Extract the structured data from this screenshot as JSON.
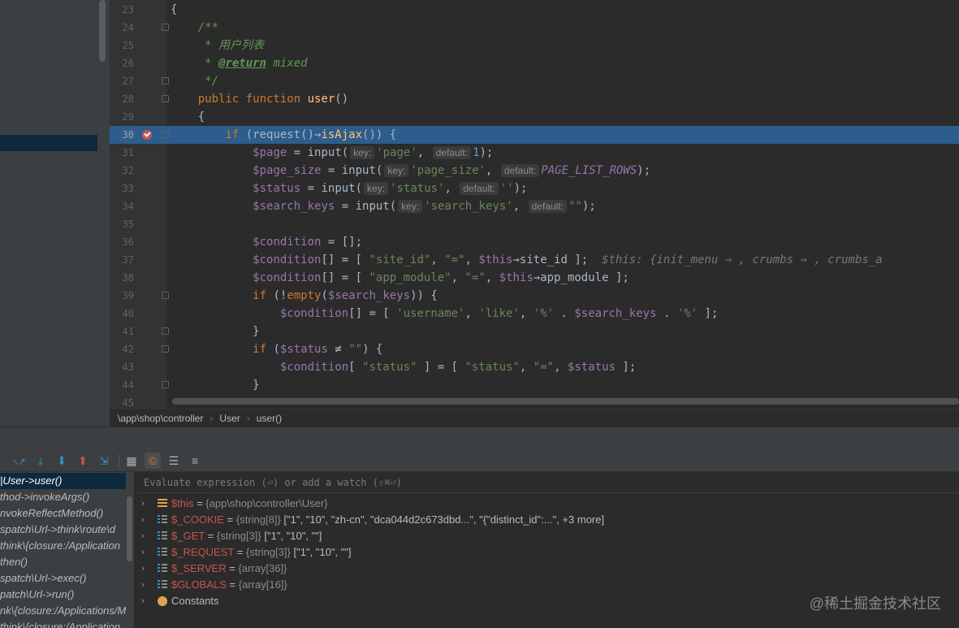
{
  "editor": {
    "lines": [
      {
        "n": "23",
        "tokens": [
          [
            "p",
            "{"
          ]
        ]
      },
      {
        "n": "24",
        "fold": true,
        "tokens": [
          [
            "p",
            "    "
          ],
          [
            "com",
            "/**"
          ]
        ]
      },
      {
        "n": "25",
        "tokens": [
          [
            "com",
            "     * 用户列表"
          ]
        ]
      },
      {
        "n": "26",
        "tokens": [
          [
            "com",
            "     * "
          ],
          [
            "tag",
            "@return"
          ],
          [
            "com",
            " mixed"
          ]
        ]
      },
      {
        "n": "27",
        "fold": true,
        "tokens": [
          [
            "com",
            "     */"
          ]
        ]
      },
      {
        "n": "28",
        "fold": true,
        "tokens": [
          [
            "p",
            "    "
          ],
          [
            "kw",
            "public function "
          ],
          [
            "fn",
            "user"
          ],
          [
            "p",
            "()"
          ]
        ]
      },
      {
        "n": "29",
        "tokens": [
          [
            "p",
            "    {"
          ]
        ]
      },
      {
        "n": "30",
        "hl": true,
        "bp": true,
        "fold": true,
        "tokens": [
          [
            "p",
            "        "
          ],
          [
            "kw",
            "if "
          ],
          [
            "p",
            "(request()→"
          ],
          [
            "fn",
            "isAjax"
          ],
          [
            "p",
            "()) {"
          ]
        ]
      },
      {
        "n": "31",
        "tokens": [
          [
            "p",
            "            "
          ],
          [
            "var",
            "$page"
          ],
          [
            "p",
            " = input("
          ],
          [
            "hint",
            "key:"
          ],
          [
            "str",
            "'page'"
          ],
          [
            "p",
            ", "
          ],
          [
            "hint",
            "default:"
          ],
          [
            "num",
            "1"
          ],
          [
            "p",
            ");"
          ]
        ]
      },
      {
        "n": "32",
        "tokens": [
          [
            "p",
            "            "
          ],
          [
            "var",
            "$page_size"
          ],
          [
            "p",
            " = input("
          ],
          [
            "hint",
            "key:"
          ],
          [
            "str",
            "'page_size'"
          ],
          [
            "p",
            ", "
          ],
          [
            "hint",
            "default:"
          ],
          [
            "const",
            "PAGE_LIST_ROWS"
          ],
          [
            "p",
            ");"
          ]
        ]
      },
      {
        "n": "33",
        "tokens": [
          [
            "p",
            "            "
          ],
          [
            "var",
            "$status"
          ],
          [
            "p",
            " = input("
          ],
          [
            "hint",
            "key:"
          ],
          [
            "str",
            "'status'"
          ],
          [
            "p",
            ", "
          ],
          [
            "hint",
            "default:"
          ],
          [
            "str",
            "''"
          ],
          [
            "p",
            ");"
          ]
        ]
      },
      {
        "n": "34",
        "tokens": [
          [
            "p",
            "            "
          ],
          [
            "var",
            "$search_keys"
          ],
          [
            "p",
            " = input("
          ],
          [
            "hint",
            "key:"
          ],
          [
            "str",
            "'search_keys'"
          ],
          [
            "p",
            ", "
          ],
          [
            "hint",
            "default:"
          ],
          [
            "str",
            "\"\""
          ],
          [
            "p",
            ");"
          ]
        ]
      },
      {
        "n": "35",
        "tokens": [
          [
            "p",
            ""
          ]
        ]
      },
      {
        "n": "36",
        "tokens": [
          [
            "p",
            "            "
          ],
          [
            "var",
            "$condition"
          ],
          [
            "p",
            " = [];"
          ]
        ]
      },
      {
        "n": "37",
        "tokens": [
          [
            "p",
            "            "
          ],
          [
            "var",
            "$condition"
          ],
          [
            "p",
            "[] = [ "
          ],
          [
            "str",
            "\"site_id\""
          ],
          [
            "p",
            ", "
          ],
          [
            "str",
            "\"=\""
          ],
          [
            "p",
            ", "
          ],
          [
            "var",
            "$this"
          ],
          [
            "p",
            "→site_id ];  "
          ],
          [
            "inl",
            "$this: {init_menu ⇒ , crumbs ⇒ , crumbs_a"
          ]
        ]
      },
      {
        "n": "38",
        "tokens": [
          [
            "p",
            "            "
          ],
          [
            "var",
            "$condition"
          ],
          [
            "p",
            "[] = [ "
          ],
          [
            "str",
            "\"app_module\""
          ],
          [
            "p",
            ", "
          ],
          [
            "str",
            "\"=\""
          ],
          [
            "p",
            ", "
          ],
          [
            "var",
            "$this"
          ],
          [
            "p",
            "→app_module ];"
          ]
        ]
      },
      {
        "n": "39",
        "fold": true,
        "tokens": [
          [
            "p",
            "            "
          ],
          [
            "kw",
            "if "
          ],
          [
            "p",
            "(!"
          ],
          [
            "kw",
            "empty"
          ],
          [
            "p",
            "("
          ],
          [
            "var",
            "$search_keys"
          ],
          [
            "p",
            ")) {"
          ]
        ]
      },
      {
        "n": "40",
        "tokens": [
          [
            "p",
            "                "
          ],
          [
            "var",
            "$condition"
          ],
          [
            "p",
            "[] = [ "
          ],
          [
            "str",
            "'username'"
          ],
          [
            "p",
            ", "
          ],
          [
            "str",
            "'like'"
          ],
          [
            "p",
            ", "
          ],
          [
            "str",
            "'%'"
          ],
          [
            "p",
            " . "
          ],
          [
            "var",
            "$search_keys"
          ],
          [
            "p",
            " . "
          ],
          [
            "str",
            "'%'"
          ],
          [
            "p",
            " ];"
          ]
        ]
      },
      {
        "n": "41",
        "fold": true,
        "tokens": [
          [
            "p",
            "            }"
          ]
        ]
      },
      {
        "n": "42",
        "fold": true,
        "tokens": [
          [
            "p",
            "            "
          ],
          [
            "kw",
            "if "
          ],
          [
            "p",
            "("
          ],
          [
            "var",
            "$status"
          ],
          [
            "p",
            " ≠ "
          ],
          [
            "str",
            "\"\""
          ],
          [
            "p",
            ") {"
          ]
        ]
      },
      {
        "n": "43",
        "tokens": [
          [
            "p",
            "                "
          ],
          [
            "var",
            "$condition"
          ],
          [
            "p",
            "[ "
          ],
          [
            "str",
            "\"status\""
          ],
          [
            "p",
            " ] = [ "
          ],
          [
            "str",
            "\"status\""
          ],
          [
            "p",
            ", "
          ],
          [
            "str",
            "\"=\""
          ],
          [
            "p",
            ", "
          ],
          [
            "var",
            "$status"
          ],
          [
            "p",
            " ];"
          ]
        ]
      },
      {
        "n": "44",
        "fold": true,
        "tokens": [
          [
            "p",
            "            }"
          ]
        ]
      },
      {
        "n": "45",
        "tokens": [
          [
            "p",
            ""
          ]
        ]
      }
    ]
  },
  "breadcrumb": {
    "path": "\\app\\shop\\controller",
    "cls": "User",
    "method": "user()"
  },
  "frames": [
    "|User->user()",
    "thod->invokeArgs()",
    "nvokeReflectMethod()",
    "spatch\\Url->think\\route\\d",
    "think\\{closure:/Application",
    "then()",
    "spatch\\Url->exec()",
    "patch\\Url->run()",
    "nk\\{closure:/Applications/M",
    "think\\{closure:/Application"
  ],
  "eval_placeholder": "Evaluate expression (⏎) or add a watch (⇧⌘⏎)",
  "variables": [
    {
      "icon": "stack",
      "name": "$this",
      "type": "{app\\shop\\controller\\User}",
      "value": ""
    },
    {
      "icon": "list",
      "name": "$_COOKIE",
      "type": "{string[8]}",
      "value": "[\"1\", \"10\", \"zh-cn\", \"dca044d2c673dbd...\", \"{\"distinct_id\":...\", +3 more]"
    },
    {
      "icon": "list",
      "name": "$_GET",
      "type": "{string[3]}",
      "value": "[\"1\", \"10\", \"\"]"
    },
    {
      "icon": "list",
      "name": "$_REQUEST",
      "type": "{string[3]}",
      "value": "[\"1\", \"10\", \"\"]"
    },
    {
      "icon": "list",
      "name": "$_SERVER",
      "type": "{array[36]}",
      "value": ""
    },
    {
      "icon": "list",
      "name": "$GLOBALS",
      "type": "{array[16]}",
      "value": ""
    },
    {
      "icon": "const",
      "name": "Constants",
      "type": "",
      "value": ""
    }
  ],
  "watermark": "@稀土掘金技术社区",
  "colors": {
    "highlight": "#2d5d8c",
    "breakpoint": "#c75450",
    "keyword": "#cc7832",
    "string": "#6a8759",
    "variable": "#9876aa"
  }
}
